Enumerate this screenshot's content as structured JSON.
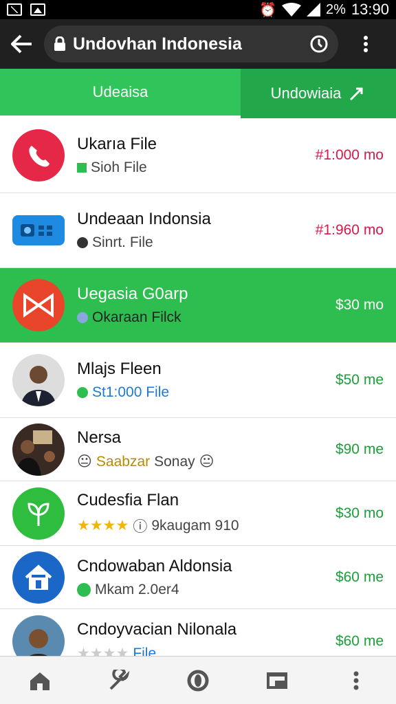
{
  "status": {
    "battery": "2%",
    "time": "13:90"
  },
  "toolbar": {
    "title": "Undovhan Indonesia"
  },
  "tabs": [
    {
      "label": "Udeaisa"
    },
    {
      "label": "Undowiaia"
    }
  ],
  "items": [
    {
      "name": "Ukarıa File",
      "sub": "Sioh File",
      "price": "#1:000 mo"
    },
    {
      "name": "Undeaan Indonsia",
      "sub": "Sinrt. File",
      "price": "#1:960 mo"
    },
    {
      "name": "Uegasia  G0arp",
      "sub": "Okaraan Filck",
      "price": "$30 mo"
    },
    {
      "name": "Mlajs Fleen",
      "sub": "St1:000 File",
      "price": "$50 me"
    },
    {
      "name": "Nersa",
      "sub_a": "Saabzar",
      "sub_b": "Sonay",
      "price": "$90 me"
    },
    {
      "name": "Cudesfia Flan",
      "sub": "9kaugam 910",
      "price": "$30 mo"
    },
    {
      "name": "Cndowaban Aldonsia",
      "sub": "Mkam 2.0er4",
      "price": "$60 me"
    },
    {
      "name": "Cndoyvacian Nilonala",
      "sub": "File",
      "price": "$60 me"
    }
  ]
}
